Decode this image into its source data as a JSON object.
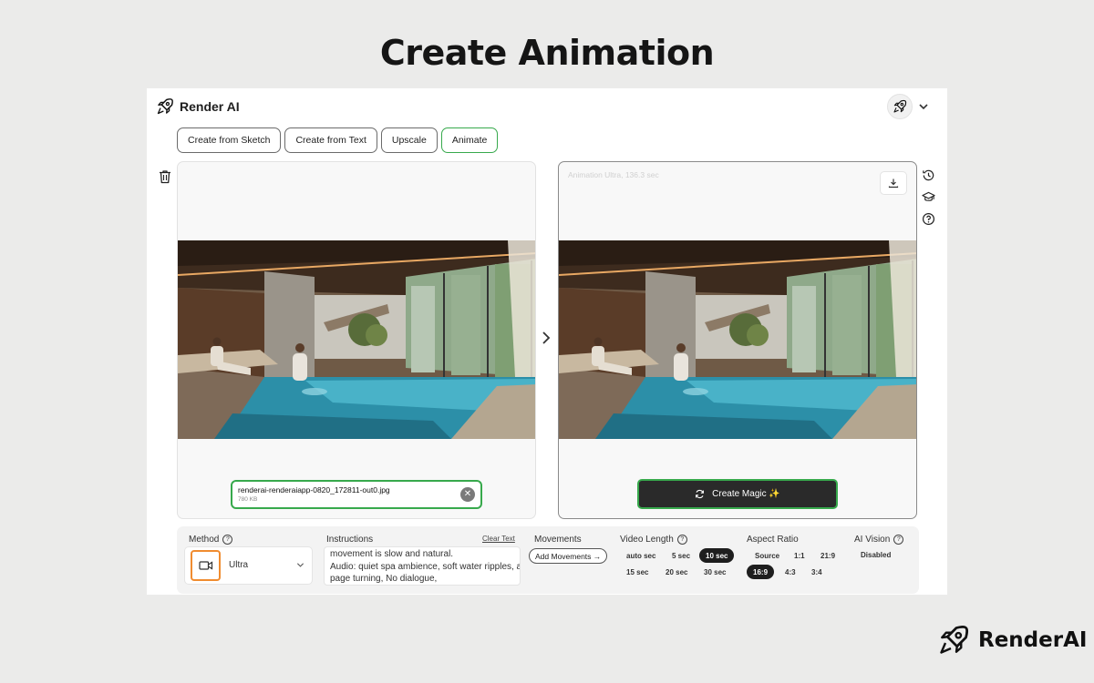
{
  "page_title": "Create Animation",
  "app": {
    "name": "Render AI",
    "tabs": [
      {
        "label": "Create from Sketch"
      },
      {
        "label": "Create from Text"
      },
      {
        "label": "Upscale"
      },
      {
        "label": "Animate",
        "active": true
      }
    ]
  },
  "upload": {
    "file_name": "renderai-renderaiapp-0820_172811-out0.jpg",
    "file_size": "780 KB"
  },
  "result": {
    "caption": "Animation Ultra, 136.3 sec",
    "create_button": "Create Magic ✨"
  },
  "settings": {
    "method": {
      "label": "Method",
      "value": "Ultra"
    },
    "instructions": {
      "label": "Instructions",
      "clear_label": "Clear Text",
      "lines": [
        "movement is slow and natural.",
        "Audio: quiet spa ambience, soft water ripples, a",
        "page turning, No dialogue,"
      ]
    },
    "movements": {
      "label": "Movements",
      "button": "Add Movements →"
    },
    "video_length": {
      "label": "Video Length",
      "options": [
        "auto sec",
        "5 sec",
        "10 sec",
        "15 sec",
        "20 sec",
        "30 sec"
      ],
      "selected": "10 sec"
    },
    "aspect_ratio": {
      "label": "Aspect Ratio",
      "options": [
        "Source",
        "1:1",
        "21:9",
        "16:9",
        "4:3",
        "3:4"
      ],
      "selected": "16:9"
    },
    "ai_vision": {
      "label": "AI Vision",
      "value": "Disabled"
    }
  },
  "footer_brand": "RenderAI",
  "colors": {
    "accent_green": "#37a94c",
    "method_orange": "#f08c30",
    "dark_button": "#2a2a2a"
  },
  "icons": [
    "rocket-icon",
    "chevron-down-icon",
    "trash-icon",
    "download-icon",
    "history-icon",
    "graduation-cap-icon",
    "help-icon",
    "refresh-icon",
    "video-camera-icon",
    "close-icon",
    "chevron-right-icon"
  ]
}
